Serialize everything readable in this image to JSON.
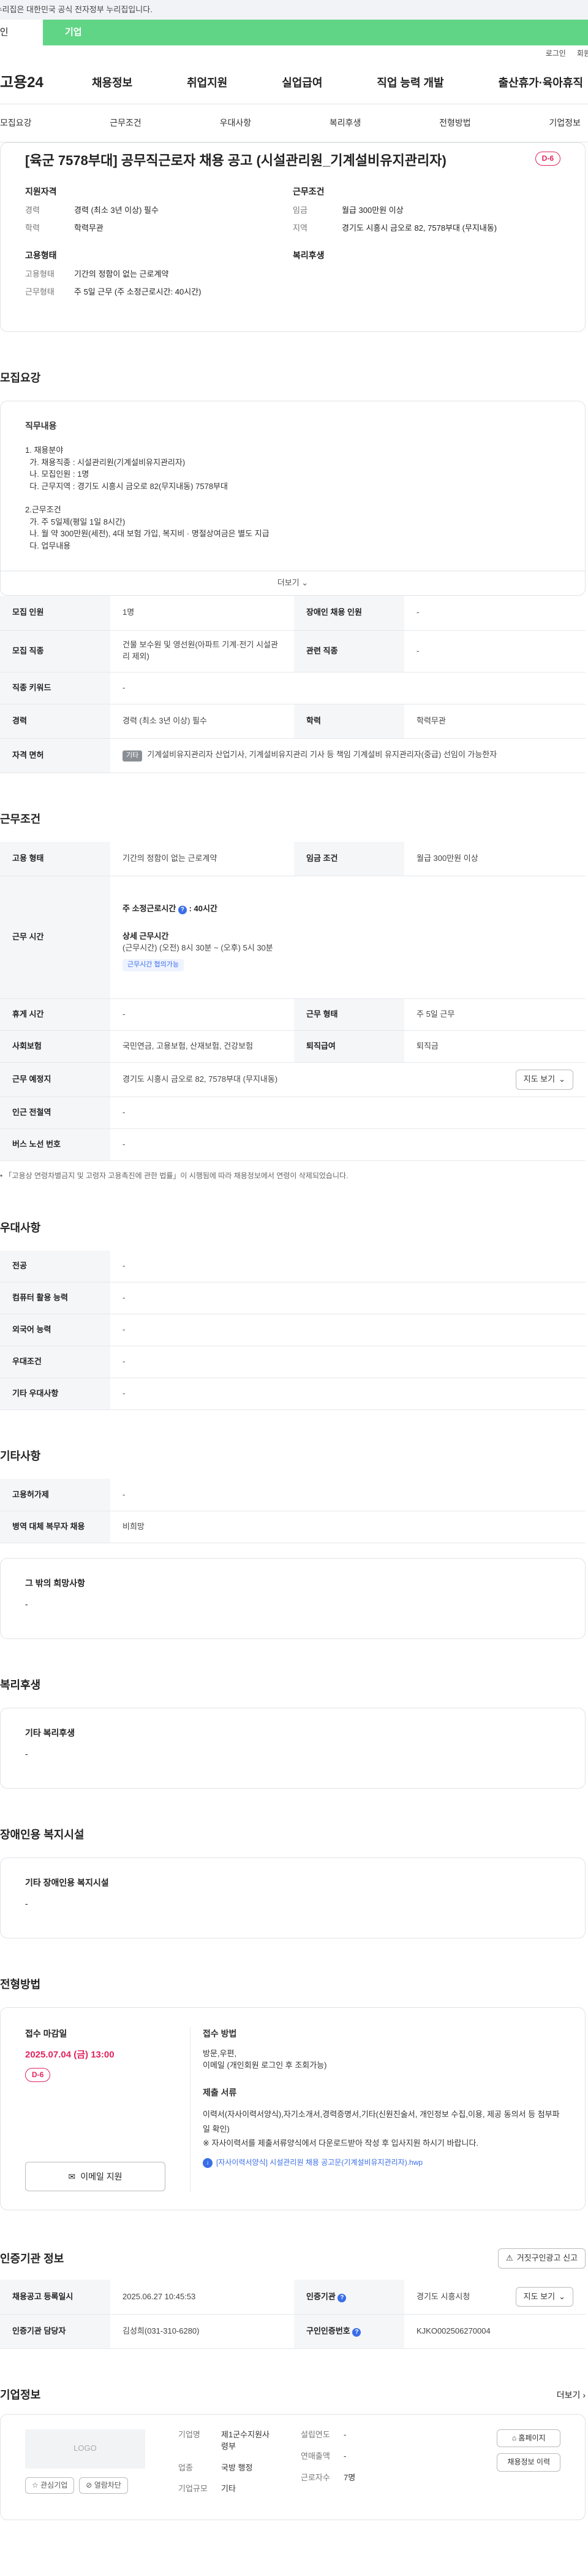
{
  "gov_banner": "이 누리집은 대한민국 공식 전자정부 누리집입니다.",
  "tabs": {
    "individual": "개인",
    "company": "기업"
  },
  "util": {
    "login": "로그인",
    "join": "회원가입"
  },
  "gnb": {
    "logo": "고용24",
    "menu": [
      "채용정보",
      "취업지원",
      "실업급여",
      "직업 능력 개발",
      "출산휴가·육아휴직"
    ]
  },
  "subnav": [
    "모집요강",
    "근무조건",
    "우대사항",
    "복리후생",
    "전형방법",
    "기업정보"
  ],
  "title": {
    "text": "[육군 7578부대] 공무직근로자 채용 공고 (시설관리원_기계설비유지관리자)",
    "dday": "D-6"
  },
  "summary": {
    "qualification": {
      "heading": "지원자격",
      "rows": [
        {
          "k": "경력",
          "v": "경력 (최소 3년 이상) 필수"
        },
        {
          "k": "학력",
          "v": "학력무관"
        }
      ]
    },
    "employment": {
      "heading": "고용형태",
      "rows": [
        {
          "k": "고용형태",
          "v": "기간의 정함이 없는 근로계약"
        },
        {
          "k": "근무형태",
          "v": "주 5일 근무 (주 소정근로시간: 40시간)"
        }
      ]
    },
    "conditions": {
      "heading": "근무조건",
      "rows": [
        {
          "k": "임금",
          "v": "월급 300만원 이상"
        },
        {
          "k": "지역",
          "v": "경기도 시흥시 금오로 82, 7578부대 (무지내동)"
        }
      ]
    },
    "welfare": {
      "heading": "복리후생"
    }
  },
  "recruit": {
    "title": "모집요강",
    "desc_heading": "직무내용",
    "desc_lines": [
      "1. 채용분야",
      "  가. 채용직종 : 시설관리원(기계설비유지관리자)",
      "  나. 모집인원 : 1명",
      "  다. 근무지역 : 경기도 시흥시 금오로 82(무지내동) 7578부대",
      "",
      "2.근무조건",
      "  가. 주 5일제(평일 1일 8시간)",
      "  나. 월 약 300만원(세전), 4대 보험 가입, 복지비 · 명절상여금은 별도 지급",
      "  다. 업무내용"
    ],
    "more": "더보기",
    "table": [
      [
        "모집 인원",
        "1명",
        "장애인 채용 인원",
        "-"
      ],
      [
        "모집 직종",
        "건물 보수원 및 영선원(아파트 기계·전기 시설관리 제외)",
        "관련 직종",
        "-"
      ],
      [
        "직종 키워드",
        "-",
        "",
        ""
      ],
      [
        "경력",
        "경력 (최소 3년 이상) 필수",
        "학력",
        "학력무관"
      ],
      [
        "자격 면허",
        "기계설비유지관리자 산업기사, 기계설비유지관리 기사 등 책임 기계설비 유지관리자(중급) 선임이 가능한자",
        "",
        ""
      ]
    ],
    "license_tag": "기타"
  },
  "work": {
    "title": "근무조건",
    "employment_type": {
      "k": "고용 형태",
      "v": "기간의 정함이 없는 근로계약",
      "k2": "임금 조건",
      "v2": "월급 300만원 이상"
    },
    "hours": {
      "k": "근무 시간",
      "weekly_label": "주 소정근로시간",
      "weekly_value": "40시간",
      "detail_label": "상세 근무시간",
      "detail_value": "(근무시간) (오전) 8시 30분 ~ (오후) 5시 30분",
      "tag": "근무시간 협의가능"
    },
    "rows": [
      [
        "휴게 시간",
        "-",
        "근무 형태",
        "주 5일 근무"
      ],
      [
        "사회보험",
        "국민연금, 고용보험, 산재보험, 건강보험",
        "퇴직급여",
        "퇴직금"
      ]
    ],
    "location": {
      "k": "근무 예정지",
      "v": "경기도 시흥시 금오로 82, 7578부대 (무지내동)",
      "btn": "지도 보기"
    },
    "station": {
      "k": "인근 전철역",
      "v": "-"
    },
    "bus": {
      "k": "버스 노선 번호",
      "v": "-"
    },
    "note": "「고용상 연령차별금지 및 고령자 고용촉진에 관한 법률」이 시행됨에 따라 채용정보에서 연령이 삭제되었습니다."
  },
  "preferences": {
    "title": "우대사항",
    "rows": [
      [
        "전공",
        "-"
      ],
      [
        "컴퓨터 활용 능력",
        "-"
      ],
      [
        "외국어 능력",
        "-"
      ],
      [
        "우대조건",
        "-"
      ],
      [
        "기타 우대사항",
        "-"
      ]
    ]
  },
  "etc": {
    "title": "기타사항",
    "rows": [
      [
        "고용허가제",
        "-"
      ],
      [
        "병역 대체 복무자 채용",
        "비희망"
      ]
    ],
    "other_heading": "그 밖의 희망사항",
    "other_value": "-"
  },
  "benefits": {
    "title": "복리후생",
    "heading": "기타 복리후생",
    "value": "-"
  },
  "disability": {
    "title": "장애인용 복지시설",
    "heading": "기타 장애인용 복지시설",
    "value": "-"
  },
  "process": {
    "title": "전형방법",
    "deadline_label": "접수 마감일",
    "deadline": "2025.07.04 (금) 13:00",
    "dday": "D-6",
    "email_btn": "이메일 지원",
    "method_heading": "접수 방법",
    "method_lines": [
      "방문,우편,",
      "이메일 (개인회원 로그인 후 조회가능)"
    ],
    "docs_heading": "제출 서류",
    "docs_lines": [
      "이력서(자사이력서양식),자기소개서,경력증명서,기타(신원진술서, 개인정보 수집,이용, 제공 동의서 등 첨부파일 확인)",
      "※ 자사이력서를 제출서류양식에서 다운로드받아 작성 후 입사지원 하시기 바랍니다."
    ],
    "file_link": "[자사이력서양식] 시설관리원 채용 공고문(기계설비유지관리자).hwp"
  },
  "cert": {
    "title": "인증기관 정보",
    "report_btn": "거짓구인광고 신고",
    "rows": [
      [
        "채용공고 등록일시",
        "2025.06.27 10:45:53",
        "인증기관",
        "경기도 시흥시청"
      ],
      [
        "인증기관 담당자",
        "김성희(031-310-6280)",
        "구인인증번호",
        "KJKO002506270004"
      ]
    ],
    "map_btn": "지도 보기"
  },
  "company": {
    "title": "기업정보",
    "more": "더보기",
    "logo_text": "LOGO",
    "fav_btn": "관심기업",
    "block_btn": "열람차단",
    "rows_left": [
      [
        "기업명",
        "제1군수지원사령부"
      ],
      [
        "업종",
        "국방 행정"
      ],
      [
        "기업규모",
        "기타"
      ]
    ],
    "rows_right": [
      [
        "설립연도",
        "-"
      ],
      [
        "연매출액",
        "-"
      ],
      [
        "근로자수",
        "7명"
      ]
    ],
    "homepage_btn": "홈페이지",
    "history_btn": "채용정보 이력"
  }
}
